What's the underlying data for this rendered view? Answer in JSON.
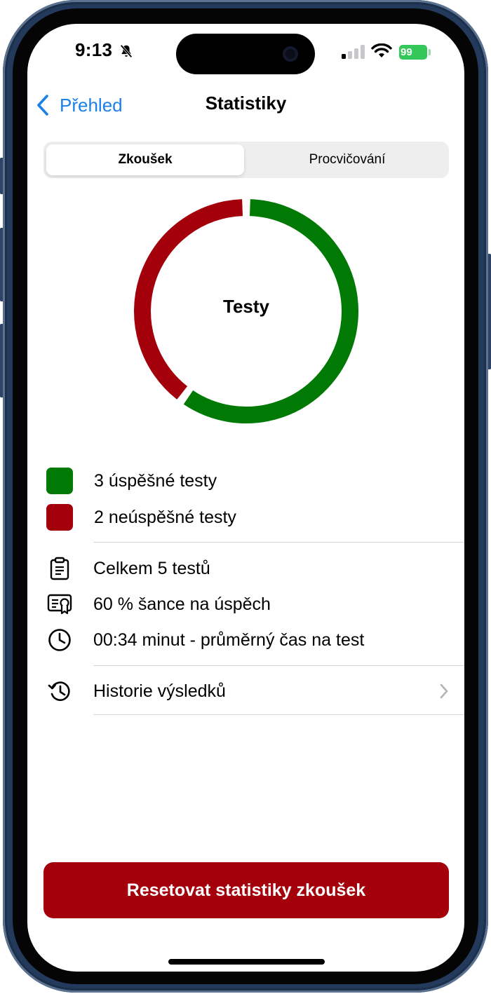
{
  "status_bar": {
    "time": "9:13",
    "battery": "99",
    "icons": [
      "bell-slash-icon",
      "cellular-signal-icon",
      "wifi-icon",
      "battery-charging-icon"
    ]
  },
  "nav": {
    "back_label": "Přehled",
    "title": "Statistiky"
  },
  "segments": [
    {
      "label": "Zkoušek",
      "selected": true
    },
    {
      "label": "Procvičování",
      "selected": false
    }
  ],
  "chart_data": {
    "type": "pie",
    "title": "Testy",
    "slices": [
      {
        "label": "3 úspěšné testy",
        "value": 3,
        "color": "#007a05"
      },
      {
        "label": "2 neúspěšné testy",
        "value": 2,
        "color": "#a4000b"
      }
    ]
  },
  "legend": [
    {
      "label": "3 úspěšné testy",
      "color": "#007a05"
    },
    {
      "label": "2 neúspěšné testy",
      "color": "#a4000b"
    }
  ],
  "stats": [
    {
      "icon": "clipboard-icon",
      "text": "Celkem 5 testů"
    },
    {
      "icon": "certificate-icon",
      "text": "60 % šance na úspěch"
    },
    {
      "icon": "clock-icon",
      "text": "00:34 minut - průměrný čas na test"
    }
  ],
  "history": {
    "icon": "history-icon",
    "label": "Historie výsledků"
  },
  "reset_button": {
    "label": "Resetovat statistiky zkoušek"
  },
  "colors": {
    "accent": "#1a80ea",
    "success": "#007a05",
    "failure": "#a4000b",
    "frame": "#243a5c"
  }
}
